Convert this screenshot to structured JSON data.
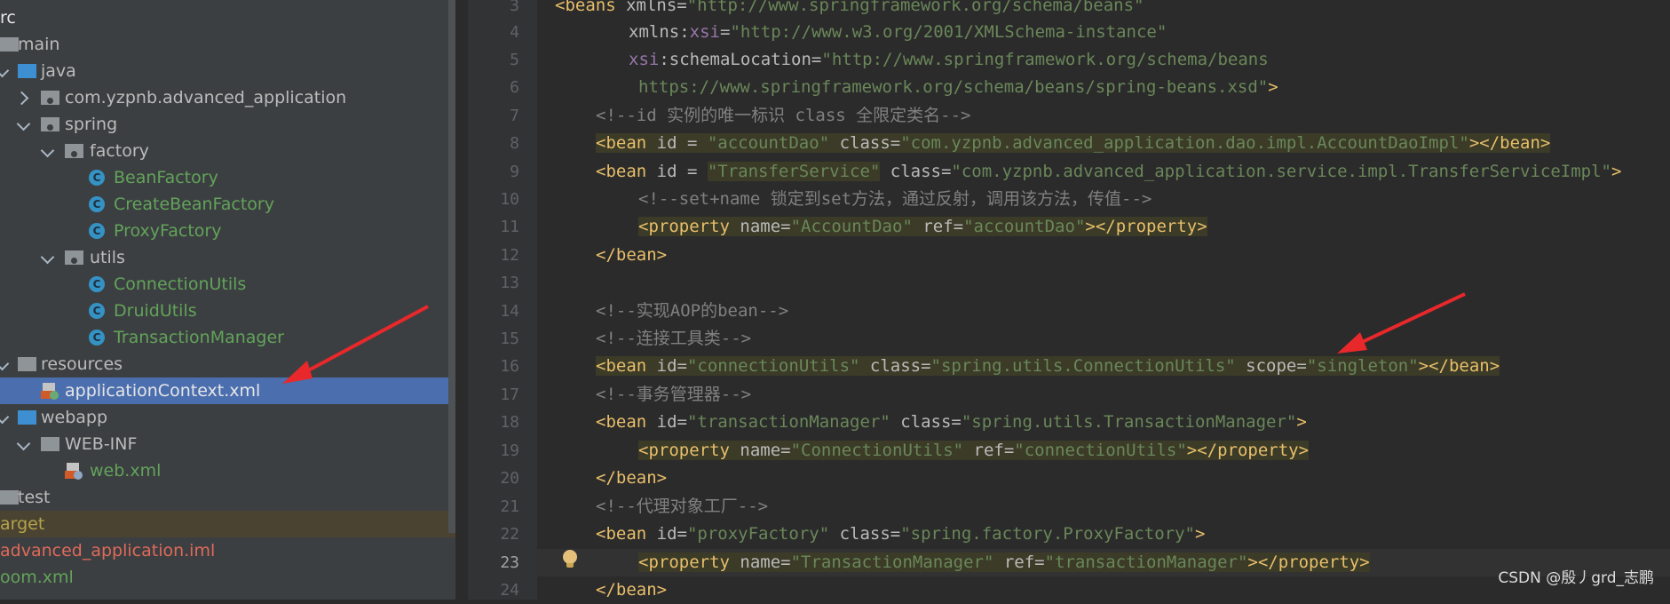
{
  "tree": {
    "rows": [
      {
        "label": "rc",
        "indent": 0
      },
      {
        "label": "main"
      },
      {
        "label": "java"
      },
      {
        "label": "com.yzpnb.advanced_application"
      },
      {
        "label": "spring"
      },
      {
        "label": "factory"
      },
      {
        "label": "BeanFactory"
      },
      {
        "label": "CreateBeanFactory"
      },
      {
        "label": "ProxyFactory"
      },
      {
        "label": "utils"
      },
      {
        "label": "ConnectionUtils"
      },
      {
        "label": "DruidUtils"
      },
      {
        "label": "TransactionManager"
      },
      {
        "label": "resources"
      },
      {
        "label": "applicationContext.xml"
      },
      {
        "label": "webapp"
      },
      {
        "label": "WEB-INF"
      },
      {
        "label": "web.xml"
      },
      {
        "label": "test"
      },
      {
        "label": "arget"
      },
      {
        "label": "advanced_application.iml"
      },
      {
        "label": "oom.xml"
      }
    ],
    "class_icon": "C"
  },
  "editor": {
    "line_numbers": [
      "3",
      "4",
      "5",
      "6",
      "7",
      "8",
      "9",
      "10",
      "11",
      "12",
      "13",
      "14",
      "15",
      "16",
      "17",
      "18",
      "19",
      "20",
      "21",
      "22",
      "23",
      "24"
    ],
    "current_line": "23",
    "lines": {
      "l3": {
        "t1": "<beans ",
        "t2": "xmlns",
        "t3": "=",
        "t4": "\"http://www.springframework.org/schema/beans\""
      },
      "l4": {
        "t1": "xmlns",
        "t2": ":",
        "t3": "xsi",
        "t4": "=",
        "t5": "\"http://www.w3.org/2001/XMLSchema-instance\""
      },
      "l5": {
        "t1": "xsi",
        "t2": ":schemaLocation",
        "t3": "=",
        "t4": "\"http://www.springframework.org/schema/beans"
      },
      "l6": {
        "t1": "https://www.springframework.org/schema/beans/spring-beans.xsd\"",
        "t2": ">"
      },
      "l7": {
        "t1": "<!--id 实例的唯一标识 class 全限定类名-->"
      },
      "l8": {
        "t1": "<bean ",
        "t2": "id",
        "t3": " = ",
        "t4": "\"accountDao\"",
        "t5": " class",
        "t6": "=",
        "t7": "\"com.yzpnb.advanced_application.dao.impl.AccountDaoImpl\"",
        "t8": "></bean>"
      },
      "l9": {
        "t1": "<bean ",
        "t2": "id",
        "t3": " = ",
        "t4": "\"TransferService\"",
        "t5": " class",
        "t6": "=",
        "t7": "\"com.yzpnb.advanced_application.service.impl.TransferServiceImpl\"",
        "t8": ">"
      },
      "l10": {
        "t1": "<!--set+name 锁定到set方法，通过反射，调用该方法，传值-->"
      },
      "l11": {
        "t1": "<property",
        "t2": " name",
        "t3": "=",
        "t4": "\"AccountDao\"",
        "t5": " ref",
        "t6": "=",
        "t7": "\"accountDao\"",
        "t8": "></property>"
      },
      "l12": {
        "t1": "</bean>"
      },
      "l14": {
        "t1": "<!--实现AOP的bean-->"
      },
      "l15": {
        "t1": "<!--连接工具类-->"
      },
      "l16": {
        "t1": "<bean ",
        "t2": "id",
        "t3": "=",
        "t4": "\"connectionUtils\"",
        "t5": " class",
        "t6": "=",
        "t7": "\"spring.utils.ConnectionUtils\"",
        "t8": " scope",
        "t9": "=",
        "t10": "\"singleton\"",
        "t11": "></bean>"
      },
      "l17": {
        "t1": "<!--事务管理器-->"
      },
      "l18": {
        "t1": "<bean ",
        "t2": "id",
        "t3": "=",
        "t4": "\"transactionManager\"",
        "t5": " class",
        "t6": "=",
        "t7": "\"spring.utils.TransactionManager\"",
        "t8": ">"
      },
      "l19": {
        "t1": "<property",
        "t2": " name",
        "t3": "=",
        "t4": "\"ConnectionUtils\"",
        "t5": " ref",
        "t6": "=",
        "t7": "\"connectionUtils\"",
        "t8": "></property>"
      },
      "l20": {
        "t1": "</bean>"
      },
      "l21": {
        "t1": "<!--代理对象工厂-->"
      },
      "l22": {
        "t1": "<bean ",
        "t2": "id",
        "t3": "=",
        "t4": "\"proxyFactory\"",
        "t5": " class",
        "t6": "=",
        "t7": "\"spring.factory.ProxyFactory\"",
        "t8": ">"
      },
      "l23": {
        "t1": "<property",
        "t2": " name",
        "t3": "=",
        "t4": "\"TransactionManager\"",
        "t5": " ref",
        "t6": "=",
        "t7": "\"transactionManager\"",
        "t8": "></property>"
      },
      "l24": {
        "t1": "</bean>"
      }
    }
  },
  "watermark": "CSDN @殷丿grd_志鹏",
  "colors": {
    "selection": "#4b6eaf",
    "arrow": "#e8282b"
  }
}
